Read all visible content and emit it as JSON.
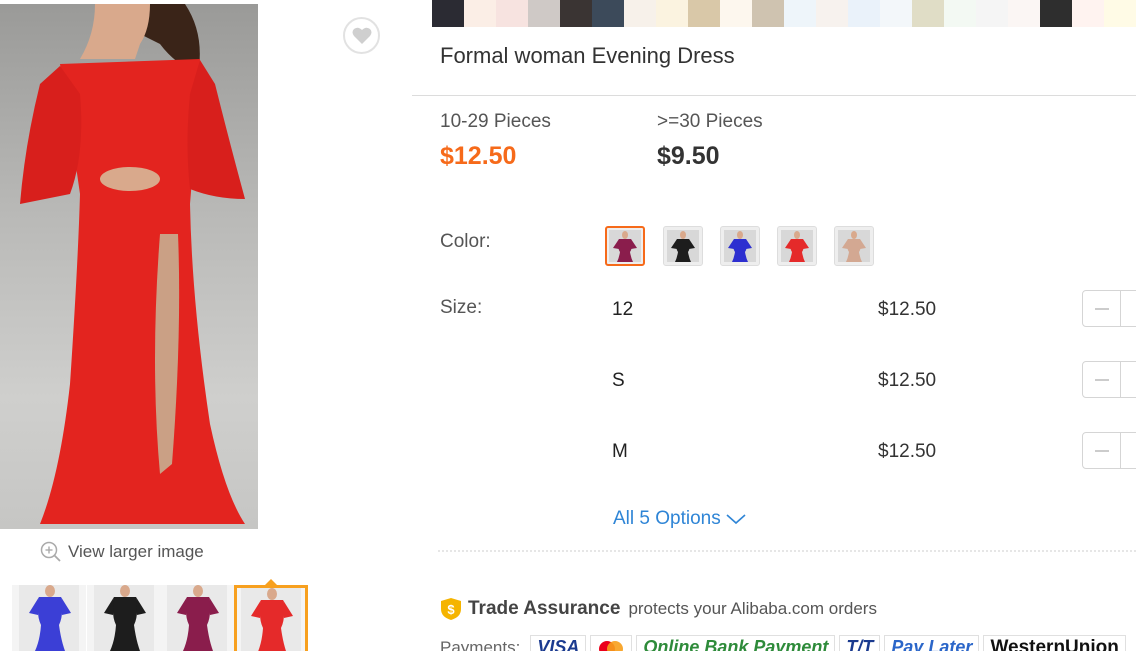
{
  "gallery": {
    "view_larger_label": "View larger image",
    "thumbnails": [
      {
        "color": "#3b3fd6",
        "active": false
      },
      {
        "color": "#1d1d1d",
        "active": false
      },
      {
        "color": "#8a1d4c",
        "active": false
      },
      {
        "color": "#e52a2a",
        "active": true
      }
    ]
  },
  "swatch_strip": [
    "#2b2b33",
    "#fbeee6",
    "#f7e3e0",
    "#cfc9c6",
    "#3a3433",
    "#3c4a5a",
    "#f7f1ea",
    "#fbf3e0",
    "#d9c8a8",
    "#fdf7ee",
    "#cfc3b0",
    "#eef5fa",
    "#f7f2ee",
    "#eaf2fa",
    "#f3f7fa",
    "#e0ddc6",
    "#f3f9f3",
    "#f5f5f5",
    "#fbf6f4",
    "#2e2e2e",
    "#fff3f0",
    "#fffbe6"
  ],
  "product": {
    "title": "Formal woman Evening Dress"
  },
  "pricing": {
    "tiers": [
      {
        "qty": "10-29 Pieces",
        "price": "$12.50"
      },
      {
        "qty": ">=30 Pieces",
        "price": "$9.50"
      }
    ],
    "accent_color": "#f66a1a"
  },
  "color": {
    "label": "Color:",
    "options": [
      {
        "name": "wine-red",
        "swatch": "#8a1d4c",
        "selected": true
      },
      {
        "name": "black",
        "swatch": "#1d1d1d",
        "selected": false
      },
      {
        "name": "royal-blue",
        "swatch": "#2d2fd0",
        "selected": false
      },
      {
        "name": "red",
        "swatch": "#e52a2a",
        "selected": false
      },
      {
        "name": "champagne",
        "swatch": "#d3a892",
        "selected": false
      }
    ]
  },
  "size": {
    "label": "Size:",
    "rows": [
      {
        "size": "12",
        "price": "$12.50"
      },
      {
        "size": "S",
        "price": "$12.50"
      },
      {
        "size": "M",
        "price": "$12.50"
      }
    ],
    "all_options_label": "All 5 Options"
  },
  "trade_assurance": {
    "title": "Trade Assurance",
    "text": "protects your Alibaba.com orders"
  },
  "payments": {
    "label": "Payments:",
    "methods": [
      {
        "label": "VISA",
        "color": "#1a3a8f"
      },
      {
        "label": "",
        "color": "#eb001b",
        "icon": "mastercard-icon"
      },
      {
        "label": "Online Bank Payment",
        "color": "#2e8b3a"
      },
      {
        "label": "T/T",
        "color": "#1a3a8f"
      },
      {
        "label": "Pay Later",
        "color": "#2b66c9"
      },
      {
        "label": "WesternUnion",
        "color": "#111111"
      }
    ]
  }
}
